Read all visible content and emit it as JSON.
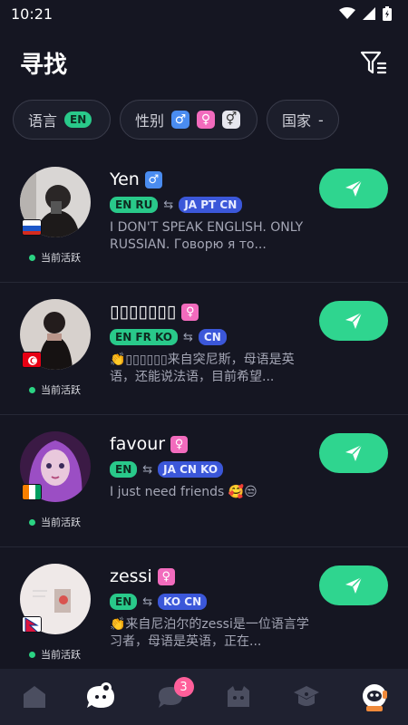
{
  "status": {
    "time": "10:21"
  },
  "header": {
    "title": "寻找"
  },
  "filters": {
    "language": {
      "label": "语言",
      "value": "EN"
    },
    "gender": {
      "label": "性别",
      "options": [
        "♂",
        "♀",
        "⚥"
      ]
    },
    "country": {
      "label": "国家",
      "value": "-"
    }
  },
  "users": [
    {
      "name": "Yen",
      "gender": "♂",
      "gender_color": "#4a8cf0",
      "native": "EN RU",
      "learning": "JA PT CN",
      "bio": "I DON'T SPEAK ENGLISH. ONLY RUSSIAN. Говорю я то...",
      "status": "当前活跃",
      "flag": "russia-flag"
    },
    {
      "name": "▯▯▯▯▯▯▯",
      "gender": "♀",
      "gender_color": "#f26bbd",
      "native": "EN FR KO",
      "learning": "CN",
      "bio": "👏▯▯▯▯▯▯来自突尼斯，母语是英语，还能说法语，目前希望...",
      "status": "当前活跃",
      "flag": "tunisia-flag"
    },
    {
      "name": "favour",
      "gender": "♀",
      "gender_color": "#f26bbd",
      "native": "EN",
      "learning": "JA CN KO",
      "bio": "I just need friends 🥰😒",
      "status": "当前活跃",
      "flag": "ivory-coast-flag"
    },
    {
      "name": "zessi",
      "gender": "♀",
      "gender_color": "#f26bbd",
      "native": "EN",
      "learning": "KO CN",
      "bio": "👏来自尼泊尔的zessi是一位语言学习者，母语是英语，正在...",
      "status": "当前活跃",
      "flag": "nepal-flag"
    }
  ],
  "tabbar": {
    "chat_badge": "3"
  }
}
